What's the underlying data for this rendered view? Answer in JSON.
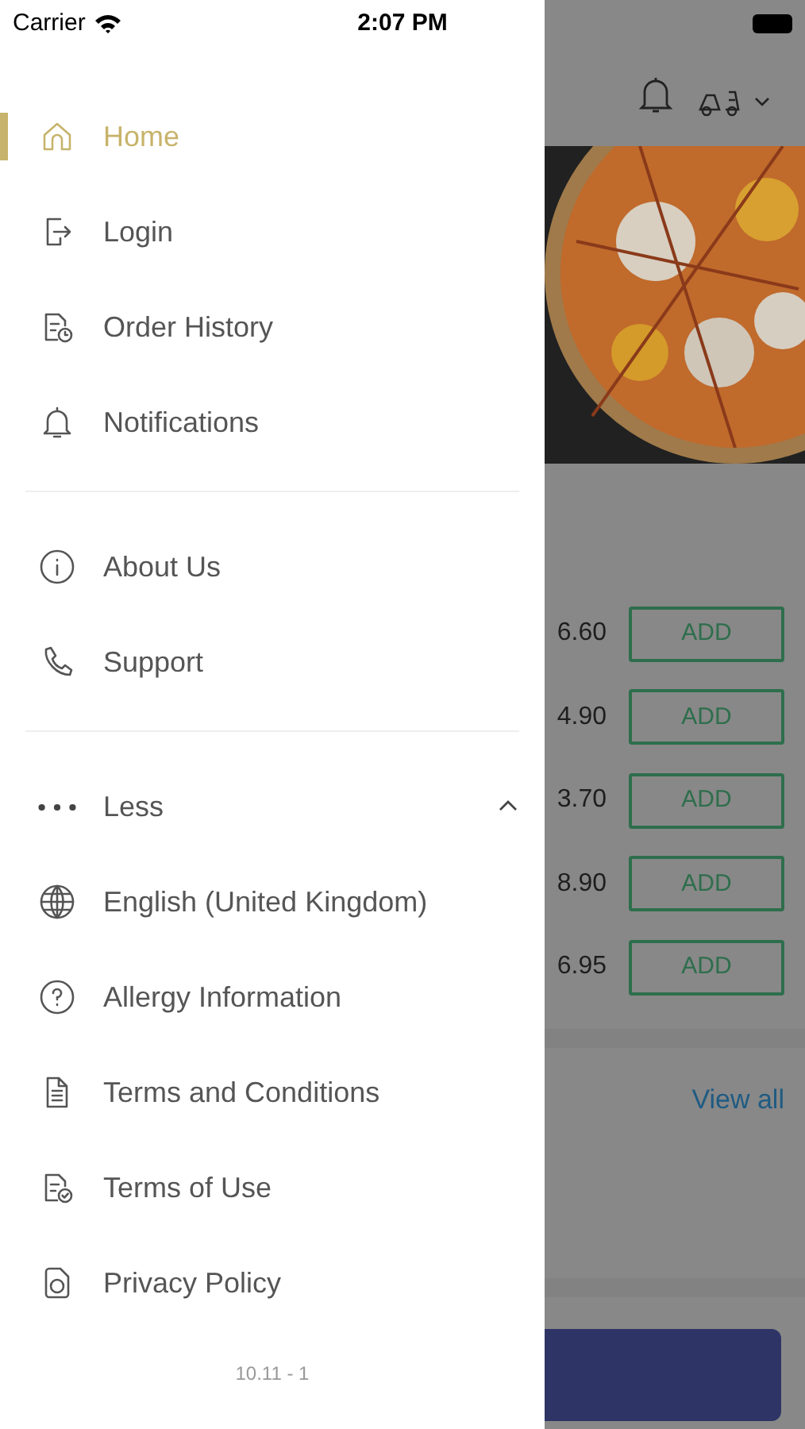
{
  "status_bar": {
    "carrier": "Carrier",
    "time": "2:07 PM"
  },
  "menu_sections": [
    {
      "items": [
        {
          "label": "Home",
          "kind": "home",
          "selected": true
        },
        {
          "label": "Login",
          "kind": "login",
          "selected": false
        },
        {
          "label": "Order History",
          "kind": "history",
          "selected": false
        },
        {
          "label": "Notifications",
          "kind": "bell",
          "selected": false
        }
      ]
    },
    {
      "items": [
        {
          "label": "About Us",
          "kind": "info",
          "selected": false
        },
        {
          "label": "Support",
          "kind": "phone",
          "selected": false
        }
      ]
    },
    {
      "toggle": {
        "label": "Less",
        "expanded": true
      },
      "items": [
        {
          "label": "English (United Kingdom)",
          "kind": "globe",
          "selected": false
        },
        {
          "label": "Allergy Information",
          "kind": "question",
          "selected": false
        },
        {
          "label": "Terms and Conditions",
          "kind": "doc",
          "selected": false
        },
        {
          "label": "Terms of Use",
          "kind": "doccheck",
          "selected": false
        },
        {
          "label": "Privacy Policy",
          "kind": "privacy",
          "selected": false
        }
      ]
    }
  ],
  "version": "10.11 - 1",
  "background": {
    "products": [
      {
        "price": "6.60",
        "button": "ADD"
      },
      {
        "price": "4.90",
        "button": "ADD"
      },
      {
        "price": "3.70",
        "button": "ADD"
      },
      {
        "price": "8.90",
        "button": "ADD"
      },
      {
        "price": "6.95",
        "button": "ADD"
      }
    ],
    "view_all": "View all"
  }
}
